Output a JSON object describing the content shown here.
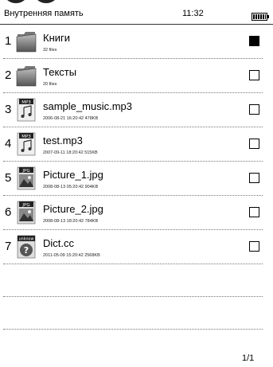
{
  "status": {
    "title": "Внутренняя память",
    "time": "11:32"
  },
  "items": [
    {
      "num": "1",
      "name": "Книги",
      "meta": "32 files",
      "icon": "folder-icon",
      "checked": true
    },
    {
      "num": "2",
      "name": "Тексты",
      "meta": "20 files",
      "icon": "folder-icon",
      "checked": false
    },
    {
      "num": "3",
      "name": "sample_music.mp3",
      "meta": "2006-08-21 16:20:42 478KB",
      "icon": "mp3-file-icon",
      "badge": "MP3",
      "checked": false
    },
    {
      "num": "4",
      "name": "test.mp3",
      "meta": "2007-09-11 18:20:42 515KB",
      "icon": "mp3-file-icon",
      "badge": "MP3",
      "checked": false
    },
    {
      "num": "5",
      "name": "Picture_1.jpg",
      "meta": "2008-08-13 05:20:42 904KB",
      "icon": "jpg-file-icon",
      "badge": "JPG",
      "checked": false
    },
    {
      "num": "6",
      "name": "Picture_2.jpg",
      "meta": "2008-08-13 18:20:42 784KB",
      "icon": "jpg-file-icon",
      "badge": "JPG",
      "checked": false
    },
    {
      "num": "7",
      "name": "Dict.cc",
      "meta": "2011-05-09 15:20:42 2568KB",
      "icon": "unknown-file-icon",
      "badge": "unknow",
      "checked": false
    }
  ],
  "pager": "1/1"
}
